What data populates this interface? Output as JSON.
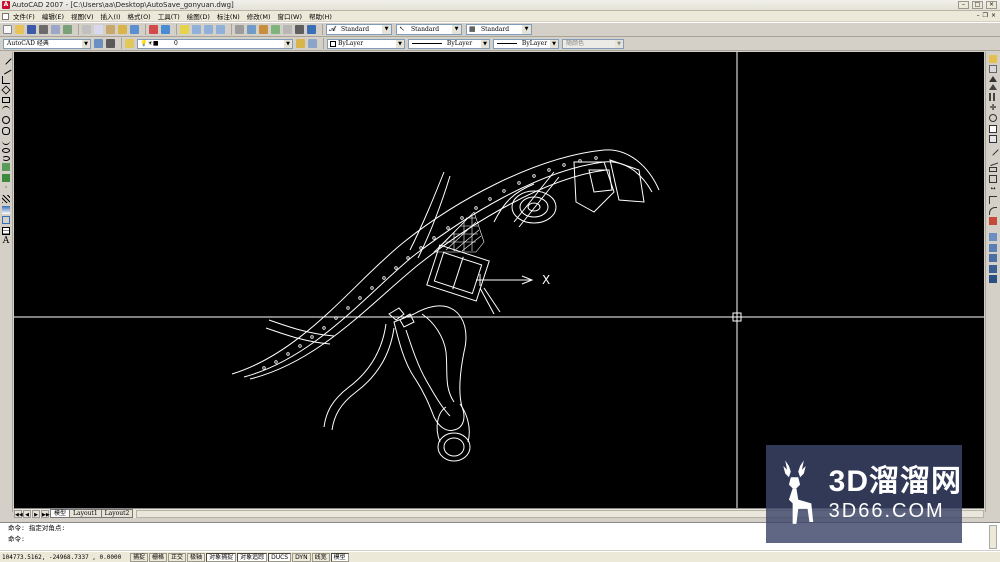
{
  "window": {
    "title": "AutoCAD 2007 - [C:\\Users\\aa\\Desktop\\AutoSave_gonyuan.dwg]",
    "app_icon_letter": "A"
  },
  "menu": {
    "items": [
      "文件(F)",
      "编辑(E)",
      "视图(V)",
      "插入(I)",
      "格式(O)",
      "工具(T)",
      "绘图(D)",
      "标注(N)",
      "修改(M)",
      "窗口(W)",
      "帮助(H)"
    ]
  },
  "toolbar": {
    "text_style": "Standard",
    "dim_style": "Standard",
    "table_style": "Standard",
    "workspace": "AutoCAD 经典",
    "layer": "0",
    "color": "ByLayer",
    "linetype": "ByLayer",
    "lineweight": "ByLayer",
    "plot_style": "随颜色"
  },
  "drawing": {
    "ucs_x_label": "X"
  },
  "tabs": {
    "items": [
      "模型",
      "Layout1",
      "Layout2"
    ],
    "active": 0
  },
  "command": {
    "line1": "命令: 指定对角点:",
    "line2": "命令:"
  },
  "status": {
    "coordinates": "104773.5162, -24968.7337 , 0.0000",
    "buttons": [
      "捕捉",
      "栅格",
      "正交",
      "极轴",
      "对象捕捉",
      "对象追踪",
      "DUCS",
      "DYN",
      "线宽",
      "模型"
    ],
    "on_buttons": [
      "对象捕捉",
      "对象追踪",
      "DUCS",
      "模型"
    ]
  },
  "watermark": {
    "brand": "3D溜溜网",
    "domain": "3D66.COM"
  },
  "colors": {
    "canvas": "#000000",
    "drawing_lines": "#ffffff",
    "chrome": "#d4d0c8",
    "watermark_bg": "#3c4669"
  }
}
